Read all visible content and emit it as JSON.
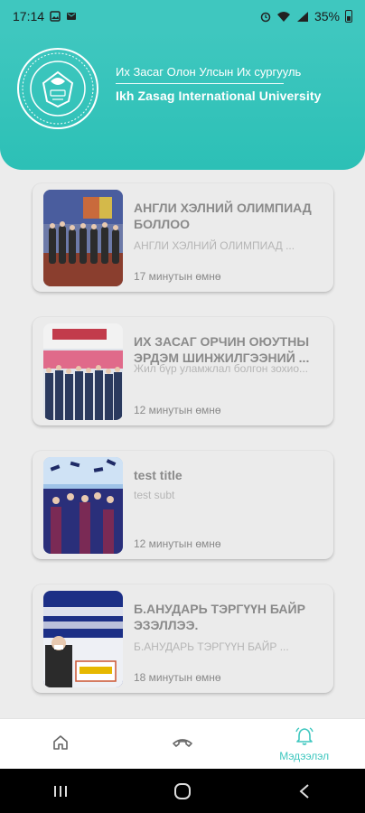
{
  "status_bar": {
    "time": "17:14",
    "battery": "35%"
  },
  "header": {
    "title_mn": "Их Засаг Олон Улсын Их сургууль",
    "title_en": "Ikh Zasag International University"
  },
  "news": [
    {
      "title": "АНГЛИ ХЭЛНИЙ ОЛИМПИАД БОЛЛОО",
      "subtitle": "АНГЛИ ХЭЛНИЙ ОЛИМПИАД ...",
      "time": "17 минутын өмнө"
    },
    {
      "title": "ИХ ЗАСАГ ОРЧИН ОЮУТНЫ ЭРДЭМ ШИНЖИЛГЭЭНИЙ ...",
      "subtitle": "Жил бүр уламжлал болгон зохио...",
      "time": "12 минутын өмнө"
    },
    {
      "title": "test title",
      "subtitle": "test subt",
      "time": "12 минутын өмнө"
    },
    {
      "title": "Б.АНУДАРЬ ТЭРГҮҮН БАЙР ЭЗЭЛЛЭЭ.",
      "subtitle": "Б.АНУДАРЬ ТЭРГҮҮН БАЙР ...",
      "time": "18 минутын өмнө"
    }
  ],
  "bottom_nav": {
    "items": [
      {
        "icon": "home-icon",
        "label": ""
      },
      {
        "icon": "phone-icon",
        "label": ""
      },
      {
        "icon": "bell-icon",
        "label": "Мэдээлэл"
      }
    ]
  },
  "colors": {
    "accent": "#3fc7bf",
    "text_muted": "#8a8a8a"
  }
}
